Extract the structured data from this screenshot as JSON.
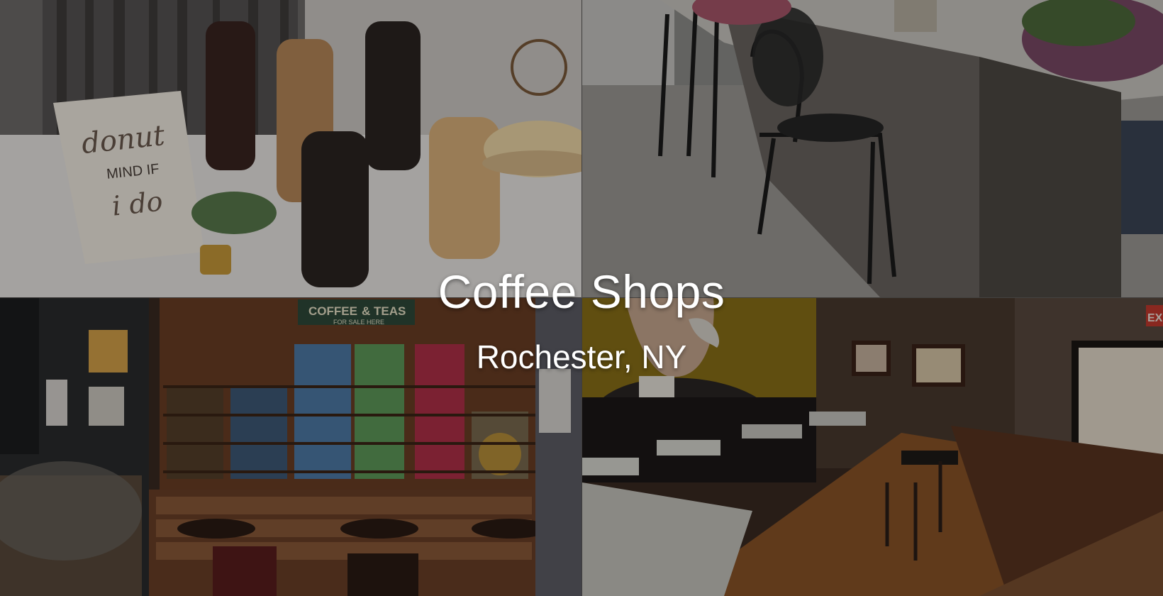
{
  "hero": {
    "title": "Coffee Shops",
    "subtitle": "Rochester, NY",
    "overlay_color": "#000000"
  },
  "photos": {
    "donut_sign": {
      "line1": "donut",
      "line2": "MIND IF",
      "line3": "i do"
    },
    "tea_shop_sign": {
      "coffee": "COFFEE",
      "amp": "&",
      "teas": "TEAS",
      "sub": "FOR SALE HERE"
    },
    "exit_sign": "EX"
  },
  "colors": {
    "text": "#ffffff",
    "divider": "#9a9a9a"
  }
}
